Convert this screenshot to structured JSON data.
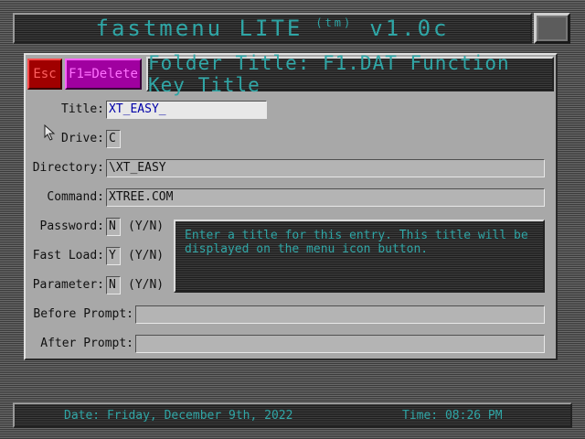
{
  "app": {
    "title": "fastmenu LITE",
    "trademark": "(tm)",
    "version": "v1.0c"
  },
  "buttons": {
    "esc": "Esc",
    "delete": "F1=Delete"
  },
  "folder_title": "Folder Title:  F1.DAT Function Key Title",
  "form": {
    "title": {
      "label": "Title:",
      "value": "XT_EASY_"
    },
    "drive": {
      "label": "Drive:",
      "value": "C"
    },
    "directory": {
      "label": "Directory:",
      "value": "\\XT_EASY"
    },
    "command": {
      "label": "Command:",
      "value": "XTREE.COM"
    },
    "password": {
      "label": "Password:",
      "value": "N",
      "hint": "(Y/N)"
    },
    "fast_load": {
      "label": "Fast Load:",
      "value": "Y",
      "hint": "(Y/N)"
    },
    "parameter": {
      "label": "Parameter:",
      "value": "N",
      "hint": "(Y/N)"
    },
    "before_prompt": {
      "label": "Before Prompt:",
      "value": ""
    },
    "after_prompt": {
      "label": "After Prompt:",
      "value": ""
    }
  },
  "help_text": "Enter a title for this entry.   This title will be displayed on the menu icon button.",
  "status": {
    "date": "Date: Friday, December 9th, 2022",
    "time": "Time: 08:26 PM"
  },
  "colors": {
    "accent": "#2fa6a6",
    "esc_bg": "#a00000",
    "delete_bg": "#a000a0",
    "panel": "#a8a8a8"
  }
}
